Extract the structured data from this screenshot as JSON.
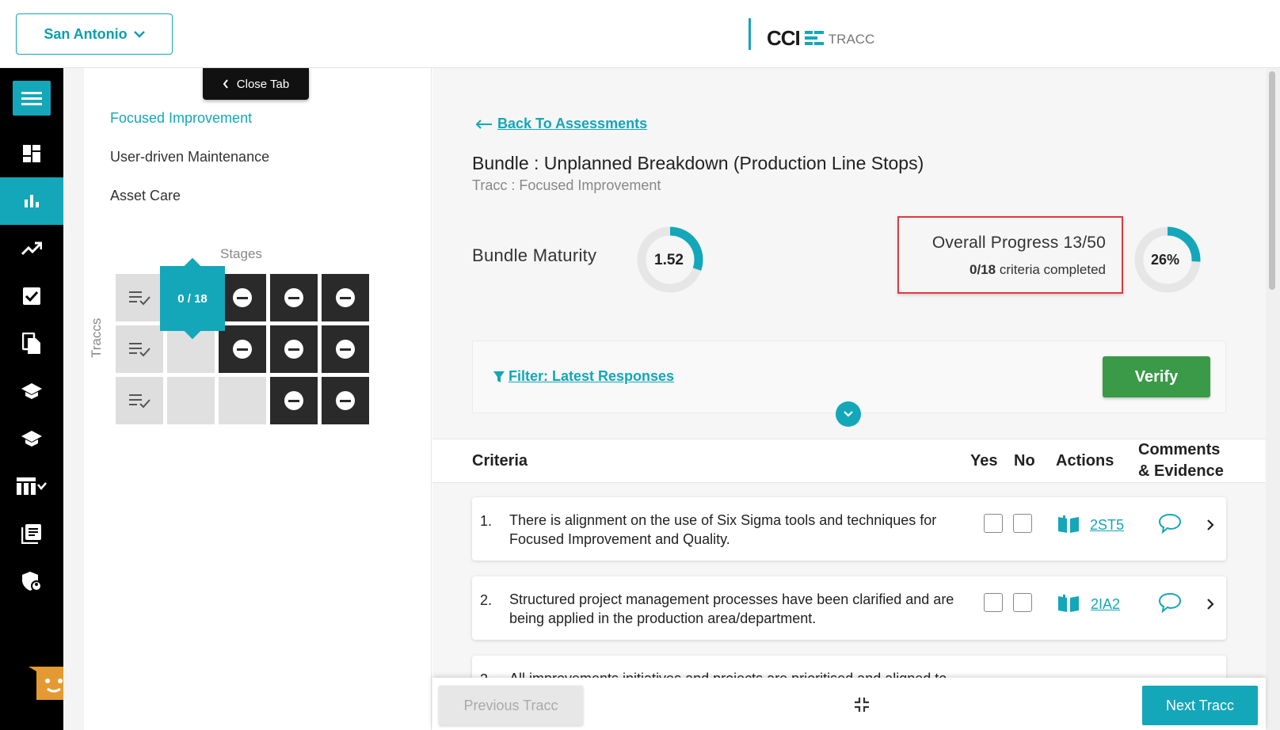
{
  "header": {
    "location": "San Antonio",
    "logo_brand": "CCI",
    "logo_product": "TRACC"
  },
  "sidebar": {
    "items": [
      "menu-icon",
      "dashboard-icon",
      "bar-chart-icon",
      "trending-icon",
      "checkbox-icon",
      "documents-icon",
      "graduation-icon",
      "learning-icon",
      "table-icon",
      "library-icon",
      "shield-user-icon"
    ],
    "active_index": 2
  },
  "tracc_panel": {
    "close_tab": "Close Tab",
    "traccs": [
      {
        "label": "Focused Improvement",
        "active": true
      },
      {
        "label": "User-driven Maintenance",
        "active": false
      },
      {
        "label": "Asset Care",
        "active": false
      }
    ],
    "stages_label": "Stages",
    "traccs_label": "Traccs",
    "active_cell": "0 / 18"
  },
  "main": {
    "back_link": "Back To Assessments",
    "bundle_title": "Bundle : Unplanned Breakdown (Production Line Stops)",
    "tracc_sub": "Tracc : Focused Improvement",
    "bundle_maturity_label": "Bundle Maturity",
    "bundle_maturity_value": "1.52",
    "bundle_maturity_fraction": 0.304,
    "overall_progress_title": "Overall Progress 13/50",
    "criteria_completed_count": "0/18",
    "criteria_completed_text": "criteria completed",
    "overall_progress_percent": "26%",
    "overall_progress_fraction": 0.26,
    "filter_link": "Filter: Latest Responses",
    "verify_label": "Verify"
  },
  "table": {
    "headers": {
      "criteria": "Criteria",
      "yes": "Yes",
      "no": "No",
      "actions": "Actions",
      "comments_line1": "Comments",
      "comments_line2": "& Evidence"
    },
    "rows": [
      {
        "num": "1.",
        "text": "There is alignment on the use of Six Sigma tools and techniques for Focused Improvement and Quality.",
        "code": "2ST5"
      },
      {
        "num": "2.",
        "text": "Structured project management processes have been clarified and are being applied in the production area/department.",
        "code": "2IA2"
      },
      {
        "num": "3.",
        "text": "All improvements initiatives and projects are prioritised and aligned to",
        "code": ""
      }
    ]
  },
  "footer": {
    "previous": "Previous Tracc",
    "next": "Next Tracc"
  },
  "colors": {
    "accent": "#13a7b9",
    "verify": "#3a9a47",
    "highlight_border": "#e0393e"
  }
}
